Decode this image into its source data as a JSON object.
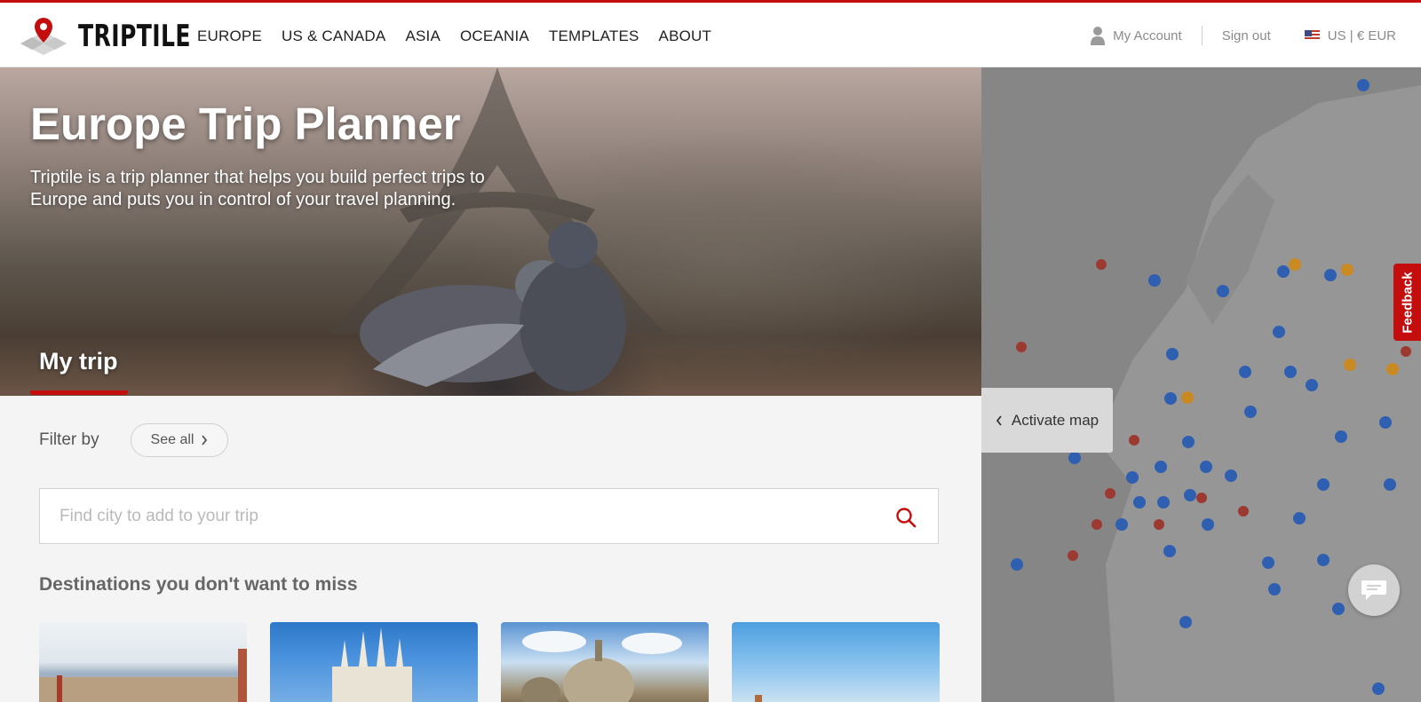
{
  "header": {
    "logo_text": "TRIPTILE",
    "nav": [
      "EUROPE",
      "US & CANADA",
      "ASIA",
      "OCEANIA",
      "TEMPLATES",
      "ABOUT"
    ],
    "account_label": "My Account",
    "signout_label": "Sign out",
    "currency_label": "US | € EUR",
    "icons": {
      "account": "user-icon",
      "flag": "us-flag-icon"
    }
  },
  "hero": {
    "title": "Europe Trip Planner",
    "description": "Triptile is a trip planner that helps you build perfect trips to Europe and puts you in control of your travel planning.",
    "my_trip": "My trip"
  },
  "filter": {
    "label": "Filter by",
    "see_all": "See all"
  },
  "search": {
    "placeholder": "Find city to add to your trip",
    "value": ""
  },
  "destinations": {
    "title": "Destinations you don't want to miss"
  },
  "map": {
    "activate_label": "Activate map"
  },
  "feedback_label": "Feedback",
  "colors": {
    "accent": "#c40d0d",
    "map_overlay": "#8b8b8b"
  }
}
